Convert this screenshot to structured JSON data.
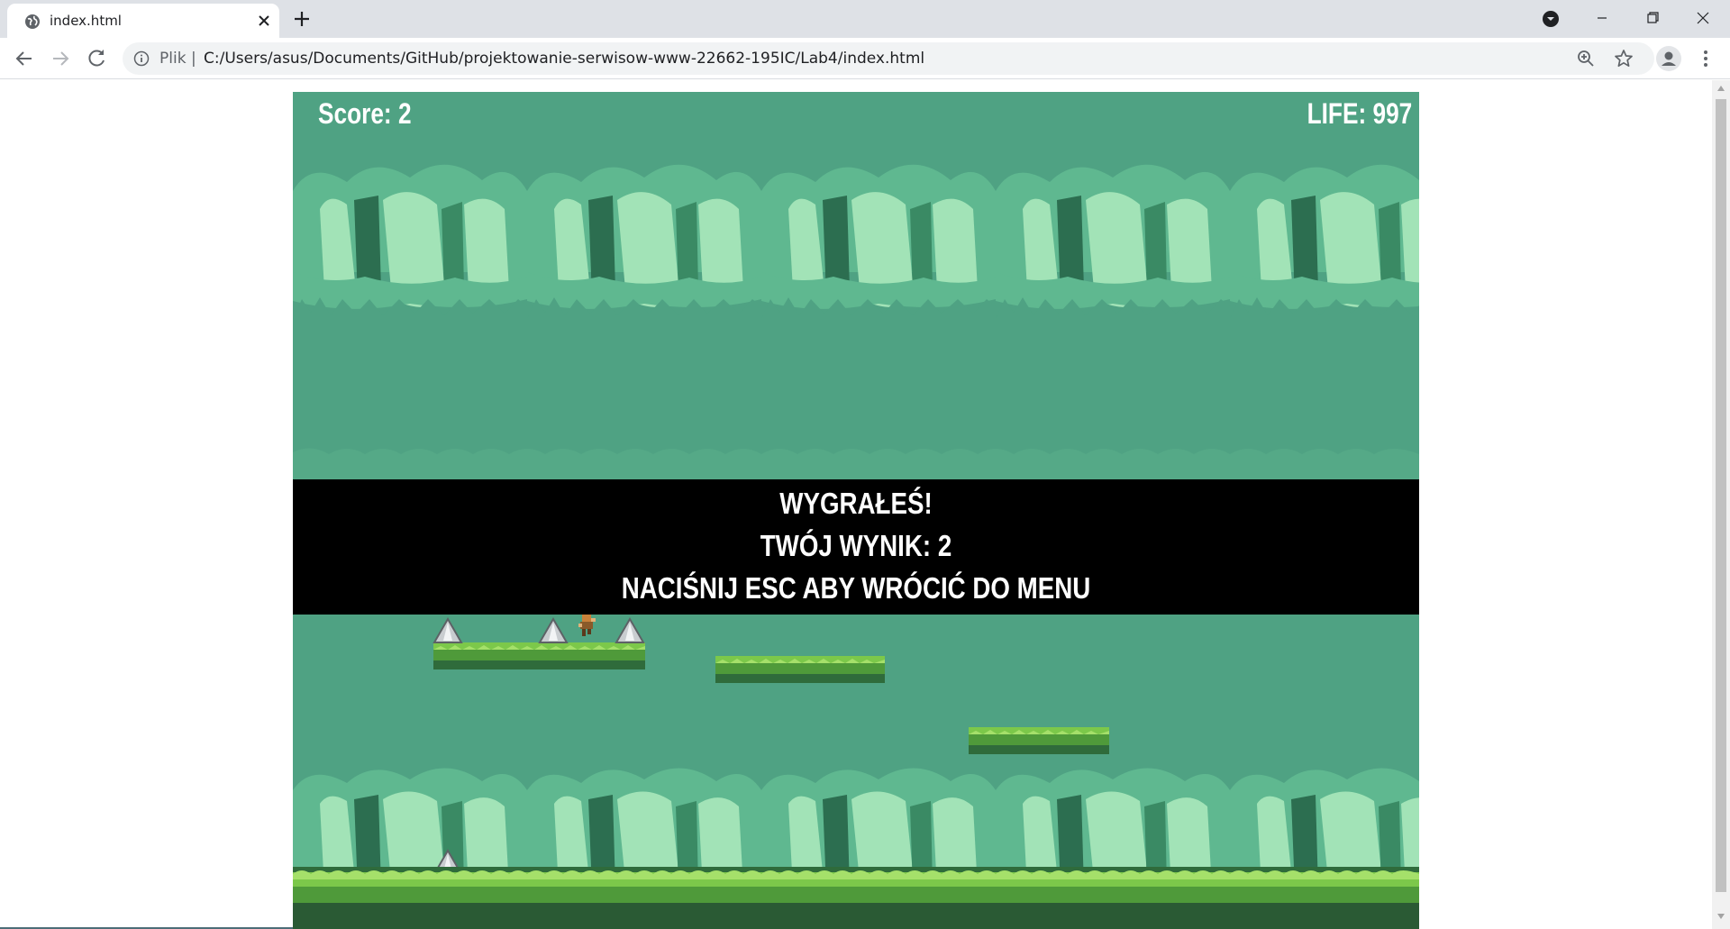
{
  "browser": {
    "tab_title": "index.html",
    "scheme_label": "Plik",
    "separator": "|",
    "url": "C:/Users/asus/Documents/GitHub/projektowanie-serwisow-www-22662-195IC/Lab4/index.html"
  },
  "game": {
    "score_text": "Score: 2",
    "life_text": "LIFE: 997",
    "banner": {
      "line1": "WYGRAŁEŚ!",
      "line2": "TWÓJ WYNIK: 2",
      "line3": "NACIŚNIJ ESC ABY WRÓCIĆ DO MENU"
    }
  },
  "colors": {
    "sky": "#4fa283",
    "tree_light": "#a2e3b7",
    "tree_mid": "#5fb890",
    "tree_dark": "#2c6e50",
    "grass_top": "#6fc23f",
    "grass_dark": "#2f6b3b",
    "banner_bg": "#000000",
    "text": "#ffffff"
  }
}
